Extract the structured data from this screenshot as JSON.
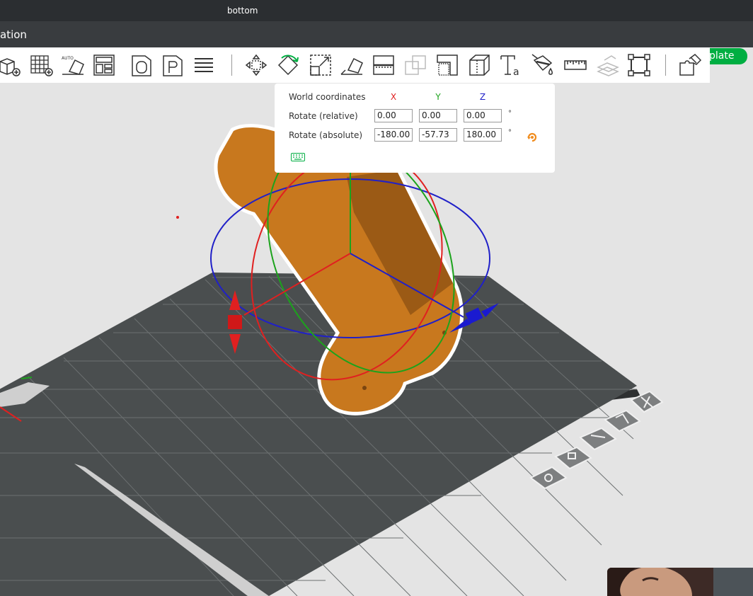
{
  "window": {
    "title": "bottom"
  },
  "menubar": {
    "tab_label": "ation",
    "slice_button": "Slice plate",
    "dropdown_glyph": "⌄"
  },
  "toolbar": {
    "items": [
      "add-object",
      "add-plate",
      "auto-orient",
      "arrange",
      "object-list",
      "plate-list",
      "layers",
      "move",
      "rotate",
      "scale",
      "lay-on-face",
      "cut",
      "boolean",
      "support-paint",
      "seam-paint",
      "text",
      "color-paint",
      "measure",
      "assembly",
      "flatten",
      "split-parts"
    ]
  },
  "rotate_panel": {
    "header": "World coordinates",
    "axes": {
      "x": "X",
      "y": "Y",
      "z": "Z"
    },
    "axis_colors": {
      "x": "#e02020",
      "y": "#1ca31c",
      "z": "#2020c8"
    },
    "relative": {
      "label": "Rotate (relative)",
      "x": "0.00",
      "y": "0.00",
      "z": "0.00",
      "unit": "°"
    },
    "absolute": {
      "label": "Rotate (absolute)",
      "x": "-180.00",
      "y": "-57.73",
      "z": "180.00",
      "unit": "°"
    }
  },
  "colors": {
    "accent": "#00ae42",
    "model": "#c8781e",
    "bed": "#4a4e4f",
    "background": "#e4e4e4"
  }
}
